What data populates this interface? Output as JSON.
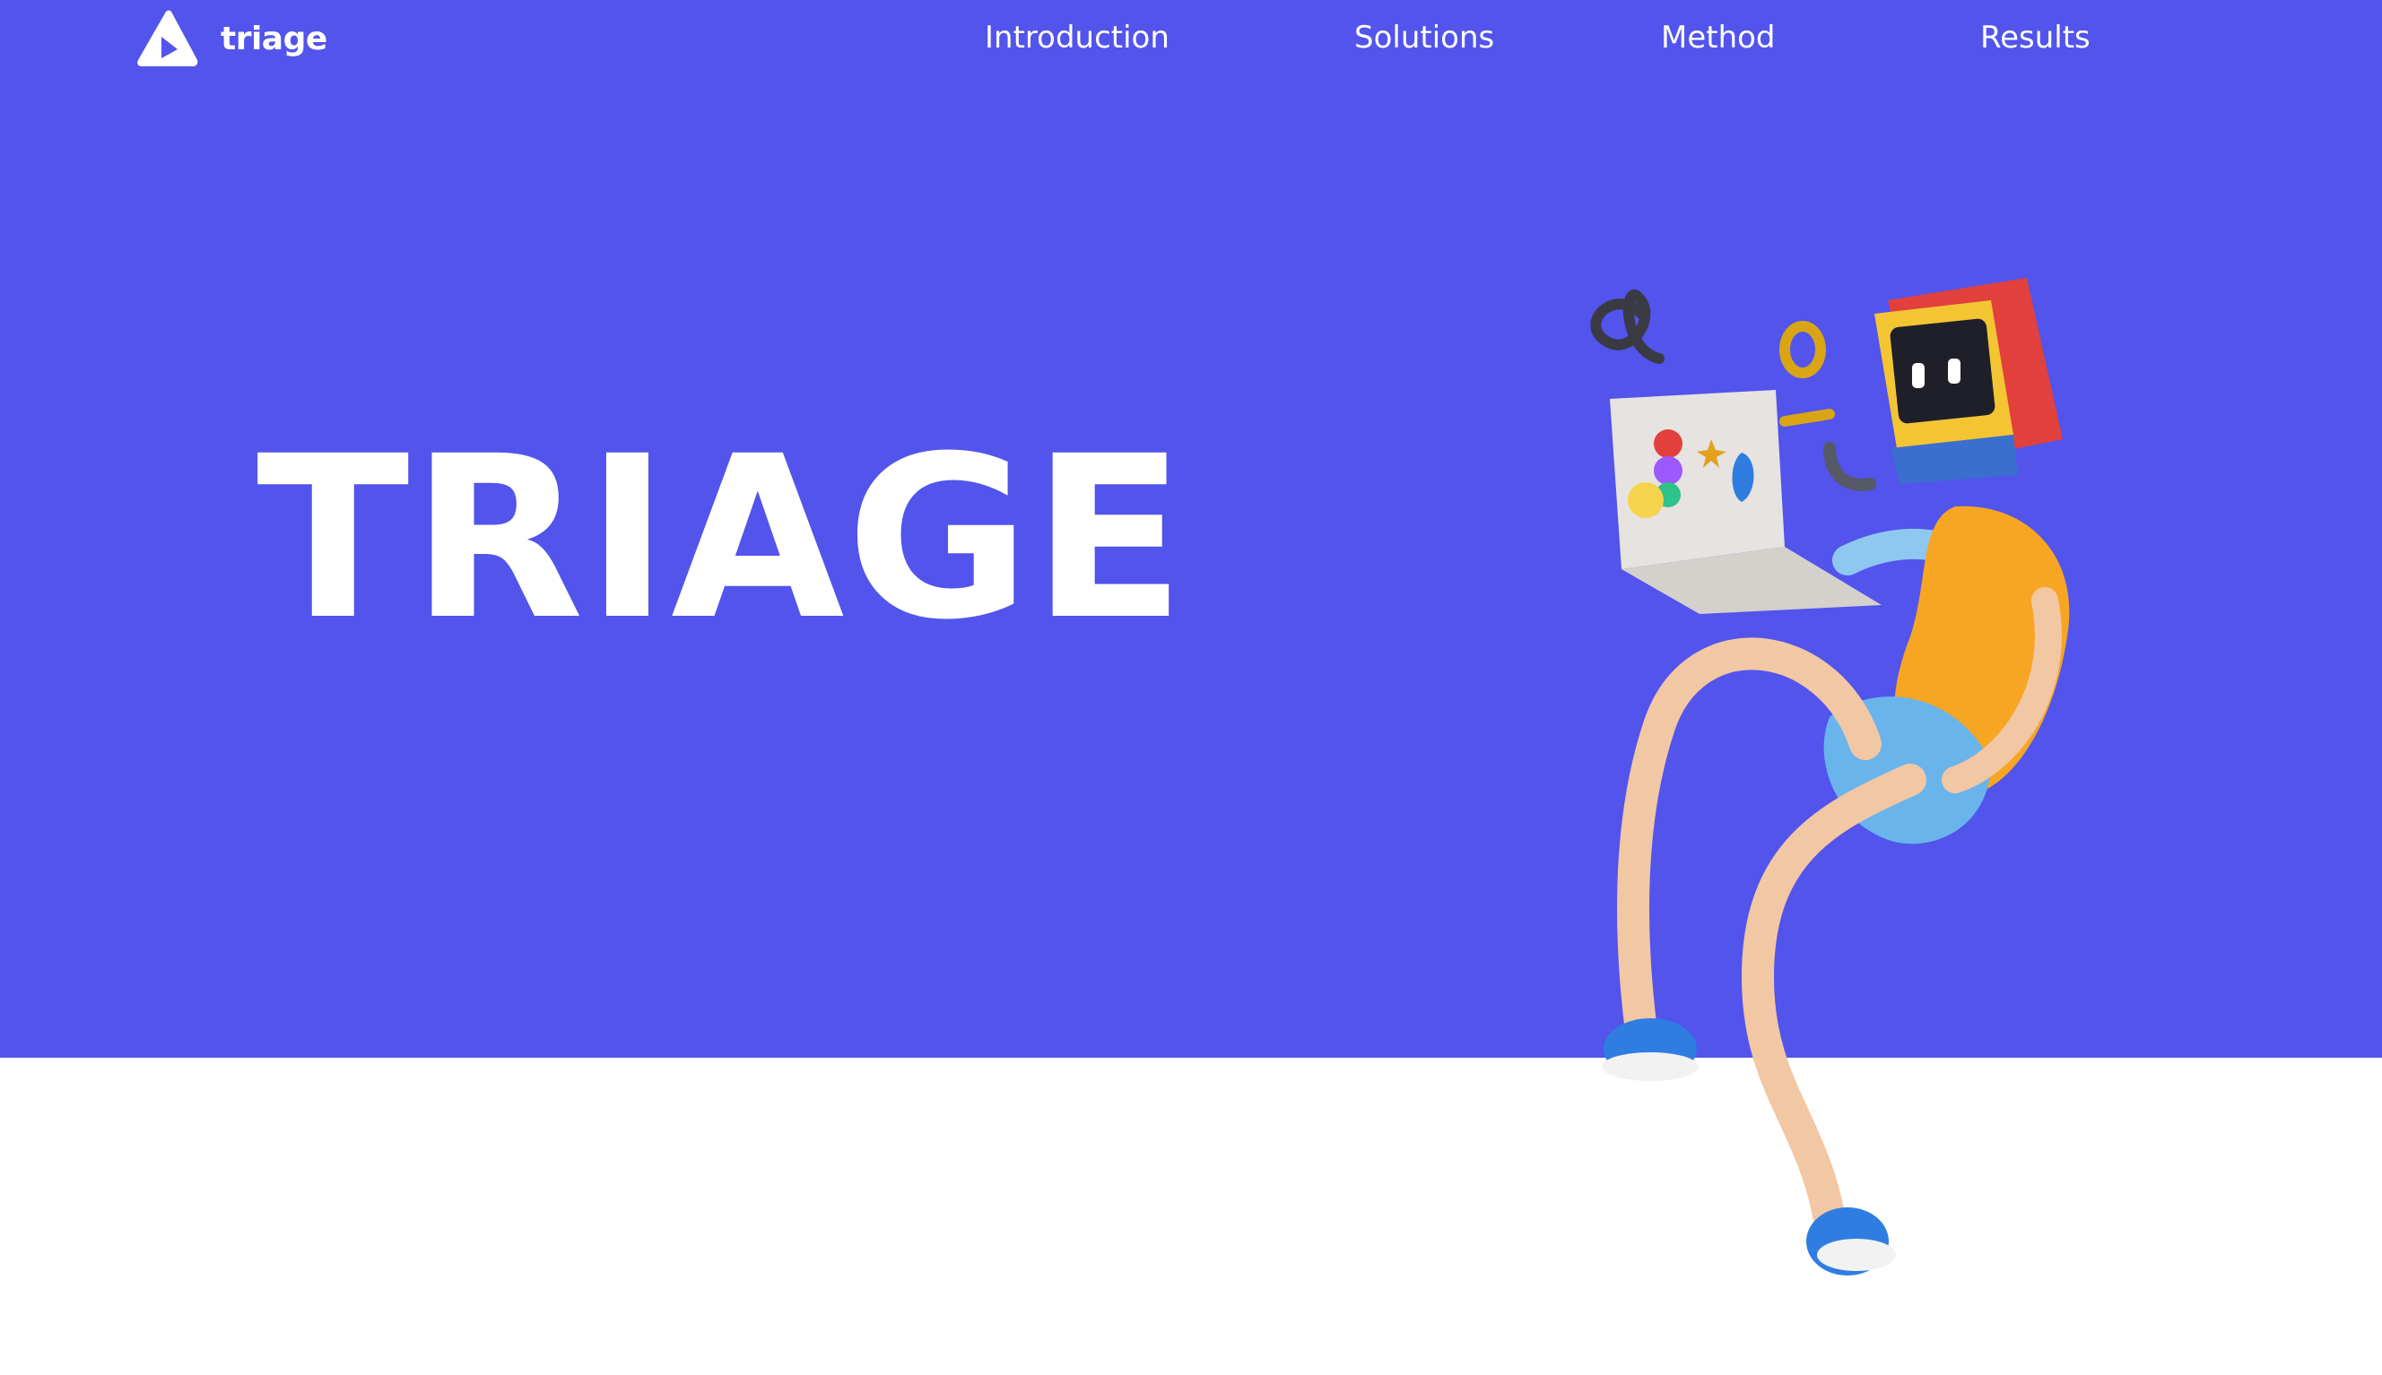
{
  "brand": {
    "name": "triage",
    "logo_icon": "triangle-play-icon"
  },
  "nav": {
    "items": [
      {
        "label": "Introduction"
      },
      {
        "label": "Solutions"
      },
      {
        "label": "Method"
      },
      {
        "label": "Results"
      }
    ]
  },
  "hero": {
    "title": "TRIAGE",
    "illustration": "3d-character-with-laptop-illustration"
  },
  "colors": {
    "hero_background": "#5254ec",
    "page_background": "#ffffff",
    "text": "#ffffff",
    "accent_orange": "#f6a623",
    "accent_blue": "#2f7de1",
    "accent_red": "#e2403c"
  }
}
